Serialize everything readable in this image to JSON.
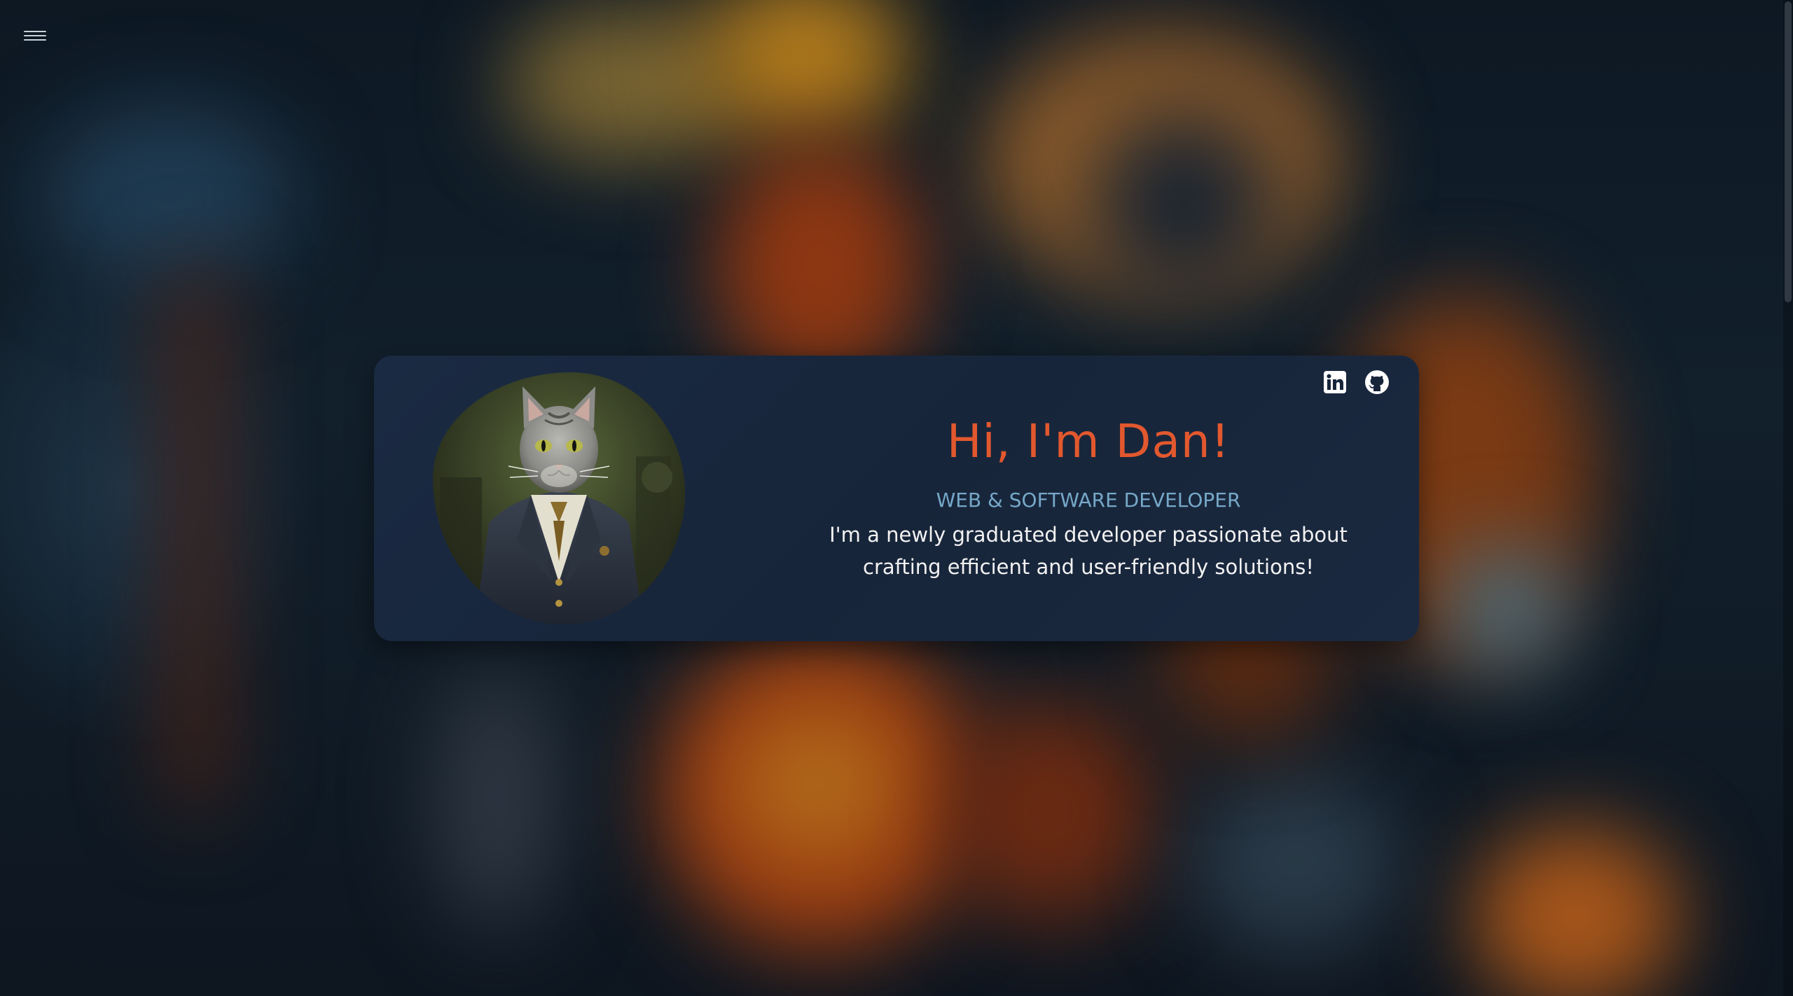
{
  "nav": {
    "menu_icon": "hamburger-menu-icon"
  },
  "hero": {
    "avatar_alt": "Portrait of a cat in a suit",
    "title": "Hi, I'm Dan!",
    "subtitle": "WEB & SOFTWARE DEVELOPER",
    "description": "I'm a newly graduated developer passionate about crafting efficient and user-friendly solutions!"
  },
  "socials": [
    {
      "icon": "linkedin-icon"
    },
    {
      "icon": "github-icon"
    }
  ],
  "colors": {
    "accent_orange": "#e2582e",
    "accent_blue": "#76a8c8",
    "card_bg": "#17253a",
    "text": "#f2f2f2"
  }
}
